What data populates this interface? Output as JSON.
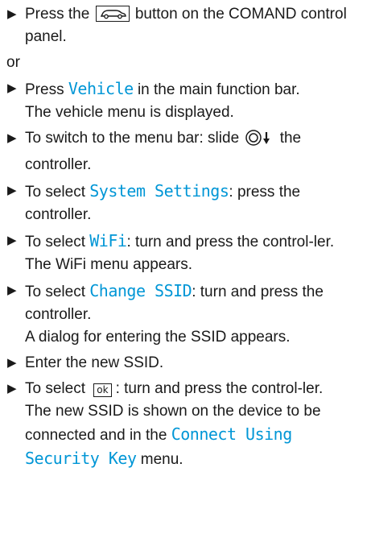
{
  "bullet_glyph": "▶",
  "steps": {
    "s1": {
      "pre": "Press the",
      "post": "button on the COMAND control panel.",
      "icon": "car-key-icon"
    },
    "or": "or",
    "s2": {
      "pre": "Press",
      "hl": "Vehicle",
      "post": "in the main function bar.",
      "line2": "The vehicle menu is displayed."
    },
    "s3": {
      "pre": "To switch to the menu bar: slide",
      "post": "the controller.",
      "icon": "controller-slide-down-icon"
    },
    "s4": {
      "pre": "To select",
      "hl": "System Settings",
      "post": ": press the controller."
    },
    "s5": {
      "pre": "To select",
      "hl": "WiFi",
      "post": ": turn and press the control-ler.",
      "line2": "The WiFi menu appears."
    },
    "s6": {
      "pre": "To select",
      "hl": "Change SSID",
      "post": ": turn and press the controller.",
      "line2": "A dialog for entering the SSID appears."
    },
    "s7": {
      "text": "Enter the new SSID."
    },
    "s8": {
      "pre": "To select",
      "ok": "ok",
      "post": ": turn and press the control-ler.",
      "line2_pre": "The new SSID is shown on the device to be connected and in the",
      "hl": "Connect Using Security Key",
      "line2_post": "menu."
    }
  },
  "colors": {
    "highlight": "#0096d6",
    "text": "#1a1a1a"
  }
}
